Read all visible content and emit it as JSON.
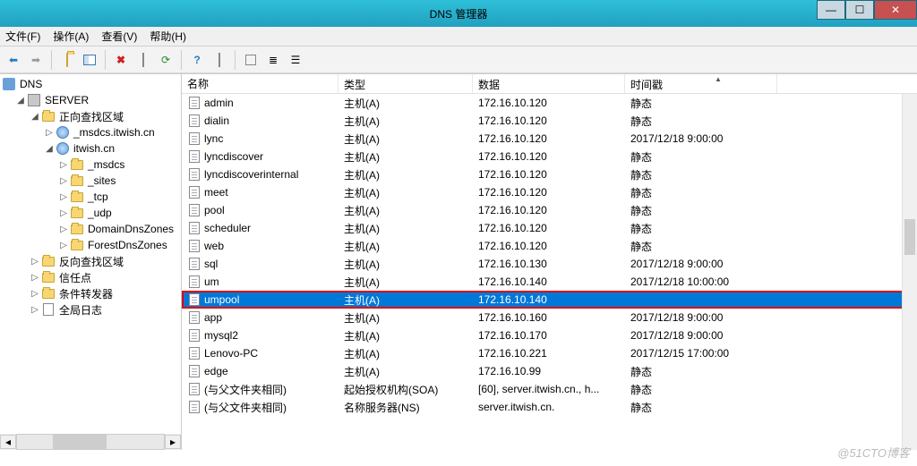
{
  "window": {
    "title": "DNS 管理器"
  },
  "menu": {
    "file": "文件(F)",
    "action": "操作(A)",
    "view": "查看(V)",
    "help": "帮助(H)"
  },
  "tree": {
    "root": "DNS",
    "server": "SERVER",
    "fwd_zone": "正向查找区域",
    "msdcs": "_msdcs.itwish.cn",
    "domain": "itwish.cn",
    "sub_msdcs": "_msdcs",
    "sub_sites": "_sites",
    "sub_tcp": "_tcp",
    "sub_udp": "_udp",
    "sub_domdns": "DomainDnsZones",
    "sub_fordns": "ForestDnsZones",
    "rev_zone": "反向查找区域",
    "trust": "信任点",
    "cond_fwd": "条件转发器",
    "global_log": "全局日志"
  },
  "columns": {
    "name": "名称",
    "type": "类型",
    "data": "数据",
    "time": "时间戳"
  },
  "records": [
    {
      "name": "admin",
      "type": "主机(A)",
      "data": "172.16.10.120",
      "time": "静态"
    },
    {
      "name": "dialin",
      "type": "主机(A)",
      "data": "172.16.10.120",
      "time": "静态"
    },
    {
      "name": "lync",
      "type": "主机(A)",
      "data": "172.16.10.120",
      "time": "2017/12/18 9:00:00"
    },
    {
      "name": "lyncdiscover",
      "type": "主机(A)",
      "data": "172.16.10.120",
      "time": "静态"
    },
    {
      "name": "lyncdiscoverinternal",
      "type": "主机(A)",
      "data": "172.16.10.120",
      "time": "静态"
    },
    {
      "name": "meet",
      "type": "主机(A)",
      "data": "172.16.10.120",
      "time": "静态"
    },
    {
      "name": "pool",
      "type": "主机(A)",
      "data": "172.16.10.120",
      "time": "静态"
    },
    {
      "name": "scheduler",
      "type": "主机(A)",
      "data": "172.16.10.120",
      "time": "静态"
    },
    {
      "name": "web",
      "type": "主机(A)",
      "data": "172.16.10.120",
      "time": "静态"
    },
    {
      "name": "sql",
      "type": "主机(A)",
      "data": "172.16.10.130",
      "time": "2017/12/18 9:00:00"
    },
    {
      "name": "um",
      "type": "主机(A)",
      "data": "172.16.10.140",
      "time": "2017/12/18 10:00:00"
    },
    {
      "name": "umpool",
      "type": "主机(A)",
      "data": "172.16.10.140",
      "time": "",
      "selected": true,
      "highlighted": true
    },
    {
      "name": "app",
      "type": "主机(A)",
      "data": "172.16.10.160",
      "time": "2017/12/18 9:00:00"
    },
    {
      "name": "mysql2",
      "type": "主机(A)",
      "data": "172.16.10.170",
      "time": "2017/12/18 9:00:00"
    },
    {
      "name": "Lenovo-PC",
      "type": "主机(A)",
      "data": "172.16.10.221",
      "time": "2017/12/15 17:00:00"
    },
    {
      "name": "edge",
      "type": "主机(A)",
      "data": "172.16.10.99",
      "time": "静态"
    },
    {
      "name": "(与父文件夹相同)",
      "type": "起始授权机构(SOA)",
      "data": "[60], server.itwish.cn., h...",
      "time": "静态"
    },
    {
      "name": "(与父文件夹相同)",
      "type": "名称服务器(NS)",
      "data": "server.itwish.cn.",
      "time": "静态"
    }
  ],
  "watermark": "@51CTO博客"
}
